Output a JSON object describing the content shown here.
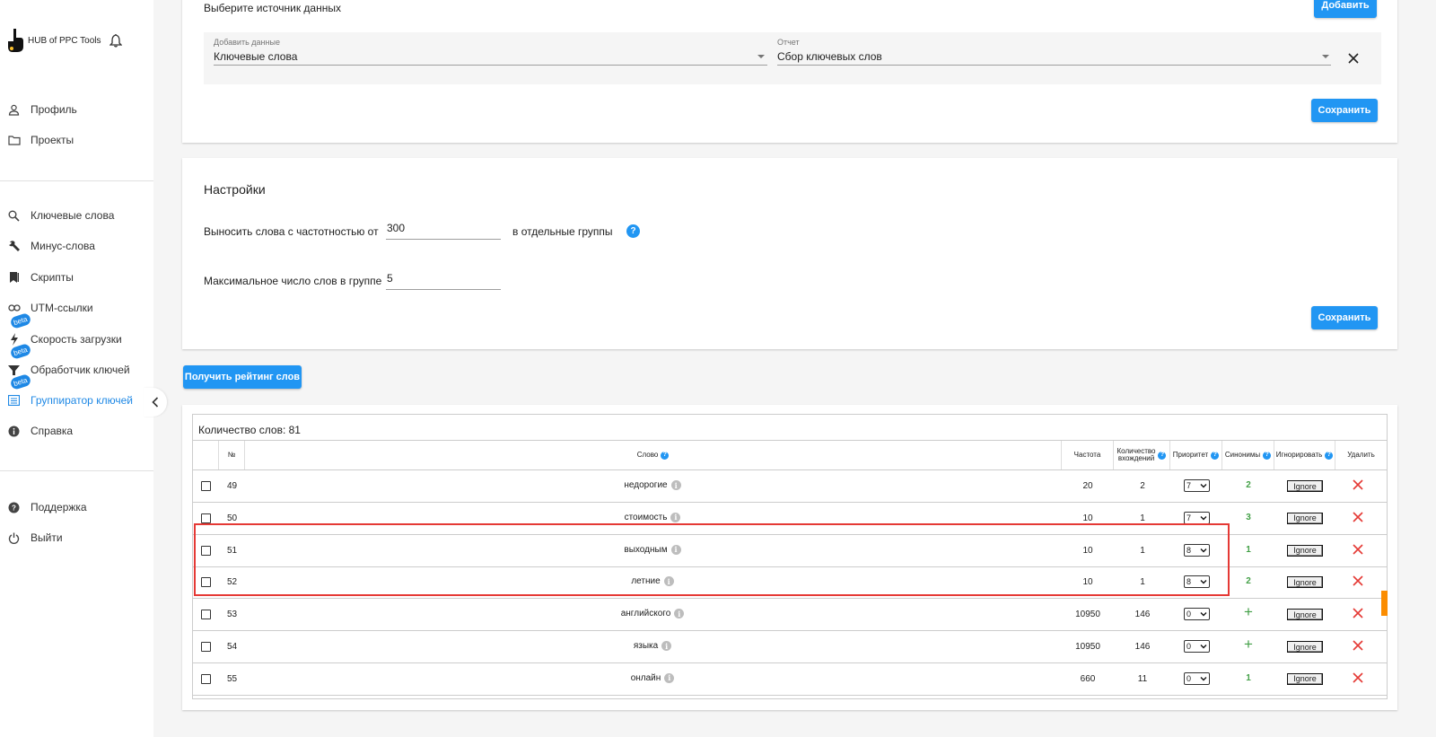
{
  "brand": {
    "name": "HUB of PPC Tools"
  },
  "sidebar": {
    "top_items": [
      {
        "label": "Профиль",
        "icon": "person-icon"
      },
      {
        "label": "Проекты",
        "icon": "folder-icon"
      }
    ],
    "tool_items": [
      {
        "label": "Ключевые слова",
        "icon": "search-icon"
      },
      {
        "label": "Минус-слова",
        "icon": "wrench-icon"
      },
      {
        "label": "Скрипты",
        "icon": "bookmark-icon"
      },
      {
        "label": "UTM-ссылки",
        "icon": "link-icon"
      },
      {
        "label": "Скорость загрузки",
        "icon": "bolt-icon",
        "badge": "beta"
      },
      {
        "label": "Обработчик ключей",
        "icon": "filter-icon",
        "badge": "beta"
      },
      {
        "label": "Группиратор ключей",
        "icon": "list-icon",
        "badge": "beta",
        "active": true
      },
      {
        "label": "Справка",
        "icon": "info-icon"
      }
    ],
    "bottom_items": [
      {
        "label": "Поддержка",
        "icon": "help-icon"
      },
      {
        "label": "Выйти",
        "icon": "power-icon"
      }
    ]
  },
  "source": {
    "title": "Выберите источник данных",
    "add_button": "Добавить",
    "data_label": "Добавить данные",
    "data_value": "Ключевые слова",
    "report_label": "Отчет",
    "report_value": "Сбор ключевых слов",
    "save_button": "Сохранить"
  },
  "settings": {
    "title": "Настройки",
    "freq_label": "Выносить слова с частотностью от",
    "freq_value": "300",
    "freq_suffix": "в отдельные группы",
    "max_label": "Максимальное число слов в группе",
    "max_value": "5",
    "save_button": "Сохранить",
    "help": "?"
  },
  "rating_button": "Получить рейтинг слов",
  "table": {
    "count_label": "Количество слов: 81",
    "headers": {
      "num": "№",
      "word": "Слово",
      "freq": "Частота",
      "occ_line1": "Количество",
      "occ_line2": "вхождений",
      "prio": "Приоритет",
      "syn": "Синонимы",
      "ign": "Игнорировать",
      "del": "Удалить"
    },
    "ignore_label": "Ignore",
    "rows": [
      {
        "num": "49",
        "word": "недорогие",
        "freq": "20",
        "occ": "2",
        "prio": "7",
        "syn": "2"
      },
      {
        "num": "50",
        "word": "стоимость",
        "freq": "10",
        "occ": "1",
        "prio": "7",
        "syn": "3"
      },
      {
        "num": "51",
        "word": "выходным",
        "freq": "10",
        "occ": "1",
        "prio": "8",
        "syn": "1"
      },
      {
        "num": "52",
        "word": "летние",
        "freq": "10",
        "occ": "1",
        "prio": "8",
        "syn": "2"
      },
      {
        "num": "53",
        "word": "английского",
        "freq": "10950",
        "occ": "146",
        "prio": "0",
        "syn": "+"
      },
      {
        "num": "54",
        "word": "языка",
        "freq": "10950",
        "occ": "146",
        "prio": "0",
        "syn": "+"
      },
      {
        "num": "55",
        "word": "онлайн",
        "freq": "660",
        "occ": "11",
        "prio": "0",
        "syn": "1"
      }
    ]
  },
  "colors": {
    "primary": "#2196f3",
    "highlight": "#e53935",
    "synonym": "#43a047",
    "delete": "#e53935"
  }
}
